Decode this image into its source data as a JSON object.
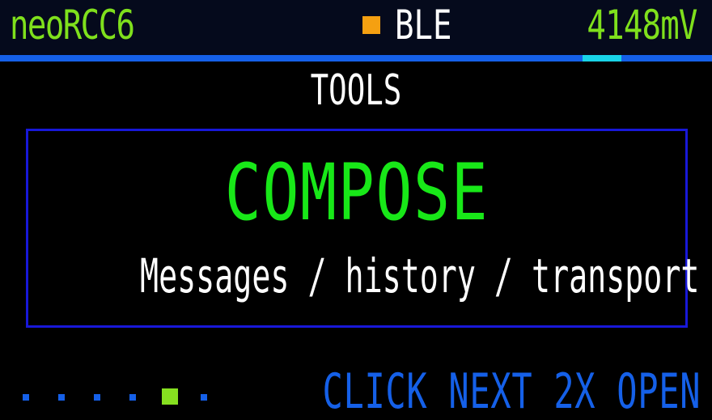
{
  "header": {
    "device_name": "neoRCC6",
    "connection_label": "BLE",
    "connection_indicator_color": "#f5a011",
    "voltage": "4148mV"
  },
  "status_bar": {
    "fill_fraction": 0.055,
    "track_color": "#1560e8",
    "fill_color": "#19d4e8"
  },
  "screen": {
    "section_title": "TOOLS"
  },
  "menu": {
    "current_item": {
      "title": "COMPOSE",
      "subtitle": "Messages / history / transport"
    },
    "title_color": "#18e818",
    "border_color": "#1818d8"
  },
  "pagination": {
    "total": 6,
    "current_index": 4
  },
  "footer": {
    "hint": "CLICK NEXT  2X OPEN"
  }
}
